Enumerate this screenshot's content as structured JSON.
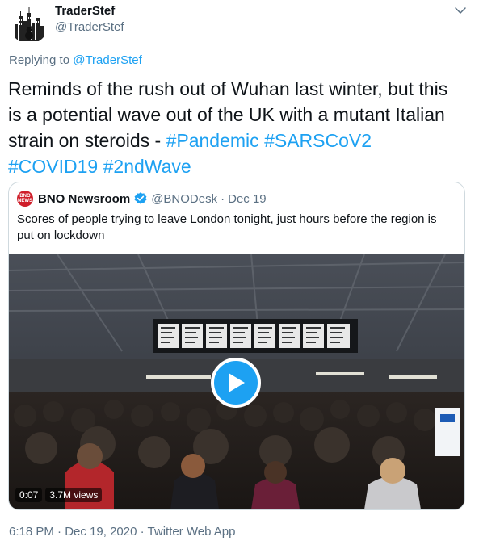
{
  "tweet": {
    "author_name": "TraderStef",
    "author_handle": "@TraderStef",
    "replying_prefix": "Replying to",
    "replying_handle": "@TraderStef",
    "text": "Reminds of the rush out of Wuhan last winter, but this is a potential wave out of the UK with a mutant Italian strain on steroids -",
    "hashtags": [
      "#Pandemic",
      "#SARSCoV2",
      "#COVID19",
      "#2ndWave"
    ],
    "time": "6:18 PM",
    "date": "Dec 19, 2020",
    "source": "Twitter Web App",
    "footer_separator": "·"
  },
  "quote": {
    "avatar_label_1": "BNO",
    "avatar_label_2": "NEWS",
    "name": "BNO Newsroom",
    "handle": "@BNODesk",
    "separator": "·",
    "date": "Dec 19",
    "text": "Scores of people trying to leave London tonight, just hours before the region is put on lockdown",
    "video": {
      "duration": "0:07",
      "views": "3.7M views"
    }
  },
  "icons": {
    "chevron": "chevron-down-icon",
    "verified": "verified-badge-icon",
    "play": "play-icon"
  },
  "colors": {
    "link": "#1da1f2",
    "secondary_text": "#5b7083",
    "primary_text": "#0f1419",
    "bno_red": "#cf1e2a"
  }
}
